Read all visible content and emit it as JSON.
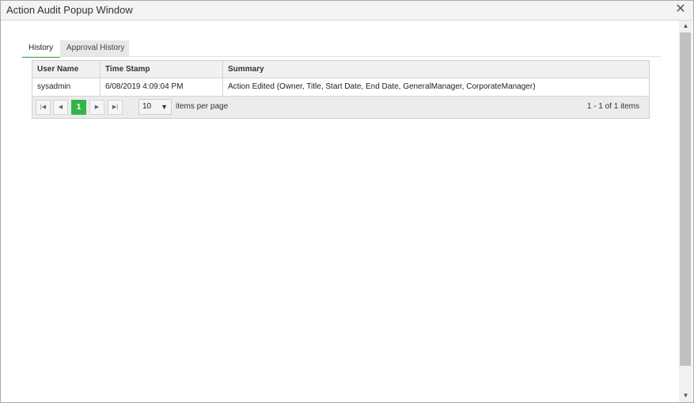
{
  "window": {
    "title": "Action Audit Popup Window",
    "close_icon": "close-icon"
  },
  "tabs": [
    {
      "label": "History",
      "active": true
    },
    {
      "label": "Approval History",
      "active": false
    }
  ],
  "grid": {
    "columns": [
      "User Name",
      "Time Stamp",
      "Summary"
    ],
    "rows": [
      [
        "sysadmin",
        "6/08/2019 4:09:04 PM",
        "Action Edited (Owner, Title, Start Date, End Date, GeneralManager, CorporateManager)"
      ]
    ]
  },
  "pager": {
    "current_page": "1",
    "page_size": "10",
    "items_per_page_label": "items per page",
    "info": "1 - 1 of 1 items",
    "icons": [
      "first-page-icon",
      "prev-page-icon",
      "next-page-icon",
      "last-page-icon"
    ]
  },
  "colors": {
    "accent": "#35b44a"
  }
}
